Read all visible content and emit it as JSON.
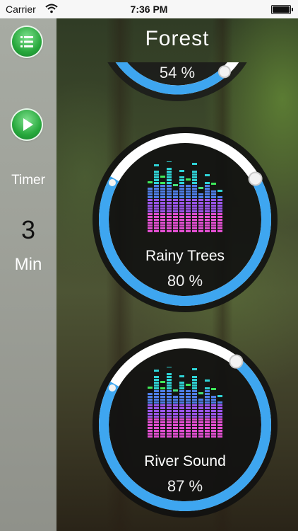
{
  "status_bar": {
    "carrier": "Carrier",
    "time": "7:36 PM"
  },
  "header": {
    "title": "Forest"
  },
  "sidebar": {
    "menu_icon": "list-icon",
    "play_icon": "play-icon",
    "timer_label": "Timer",
    "timer_value": "3",
    "timer_unit": "Min"
  },
  "colors": {
    "accent": "#3ea6f0",
    "ring_track": "#ffffff",
    "button_green": "#27a83c"
  },
  "sounds": [
    {
      "name": "",
      "volume_percent": 54,
      "volume_label": "54 %"
    },
    {
      "name": "Rainy Trees",
      "volume_percent": 80,
      "volume_label": "80 %"
    },
    {
      "name": "River Sound",
      "volume_percent": 87,
      "volume_label": "87 %"
    }
  ]
}
